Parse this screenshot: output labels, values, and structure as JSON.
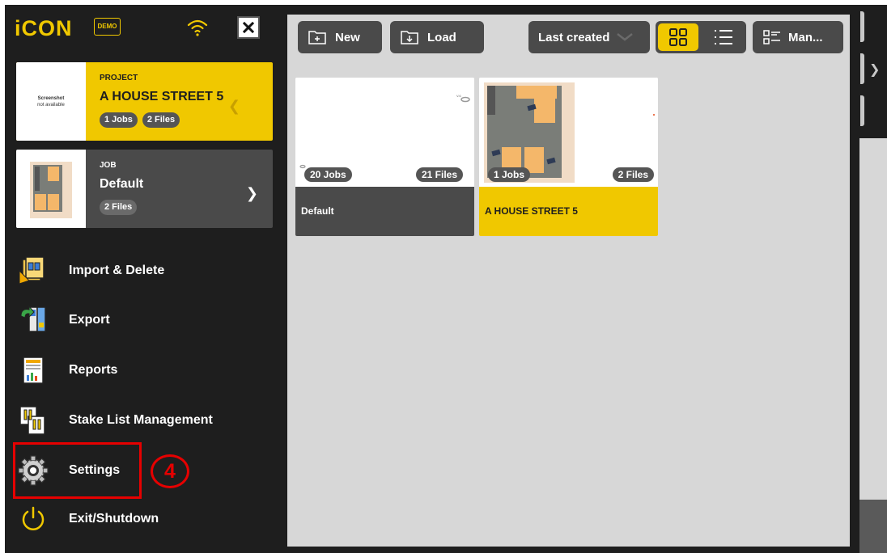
{
  "header": {
    "logo_text": "iCON",
    "demo_label": "DEMO",
    "close_label": "✕"
  },
  "project_card": {
    "thumb_text_line1": "Screenshot",
    "thumb_text_line2": "not available",
    "kind": "PROJECT",
    "name": "A HOUSE STREET 5",
    "jobs": "1 Jobs",
    "files": "2 Files",
    "chevron": "❮"
  },
  "job_card": {
    "kind": "JOB",
    "name": "Default",
    "files": "2 Files",
    "chevron": "❯"
  },
  "menu": [
    {
      "label": "Import & Delete",
      "icon": "import-delete-icon"
    },
    {
      "label": "Export",
      "icon": "export-icon"
    },
    {
      "label": "Reports",
      "icon": "reports-icon"
    },
    {
      "label": "Stake List Management",
      "icon": "stake-list-icon"
    },
    {
      "label": "Settings",
      "icon": "gear-icon"
    },
    {
      "label": "Exit/Shutdown",
      "icon": "power-icon"
    }
  ],
  "callout": "4",
  "toolbar": {
    "new_label": "New",
    "load_label": "Load",
    "sort_label": "Last created",
    "manage_label": "Man..."
  },
  "tiles": [
    {
      "name": "Default",
      "jobs": "20 Jobs",
      "files": "21 Files"
    },
    {
      "name": "A HOUSE STREET 5",
      "jobs": "1 Jobs",
      "files": "2 Files"
    }
  ],
  "right_strip": {
    "chevron": "❯"
  },
  "colors": {
    "accent": "#f0c800",
    "dark": "#1e1e1e",
    "panel": "#d7d7d7",
    "button": "#4a4a4a",
    "highlight": "#e60000"
  }
}
